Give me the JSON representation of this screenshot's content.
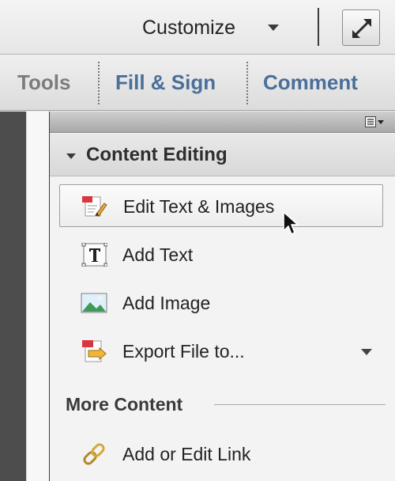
{
  "top_bar": {
    "customize_label": "Customize",
    "expand_icon": "expand-arrows-icon"
  },
  "tabs": [
    {
      "label": "Tools",
      "color": "#7c7c7c"
    },
    {
      "label": "Fill & Sign",
      "color": "#4a6f9a"
    },
    {
      "label": "Comment",
      "color": "#4a6f9a"
    }
  ],
  "panel": {
    "options_icon": "panel-options-icon",
    "section": {
      "title": "Content Editing",
      "expanded": true,
      "items": [
        {
          "label": "Edit Text & Images",
          "icon": "edit-text-images-icon",
          "selected": true
        },
        {
          "label": "Add Text",
          "icon": "add-text-icon",
          "selected": false
        },
        {
          "label": "Add Image",
          "icon": "add-image-icon",
          "selected": false
        },
        {
          "label": "Export File to...",
          "icon": "export-file-icon",
          "selected": false,
          "has_dropdown": true
        }
      ]
    },
    "more_content": {
      "heading": "More Content",
      "items": [
        {
          "label": "Add or Edit Link",
          "icon": "link-icon"
        }
      ]
    }
  },
  "colors": {
    "tab_accent": "#4a6f9a",
    "doc_dark": "#4d4d4d",
    "icon_red": "#d9373f"
  }
}
